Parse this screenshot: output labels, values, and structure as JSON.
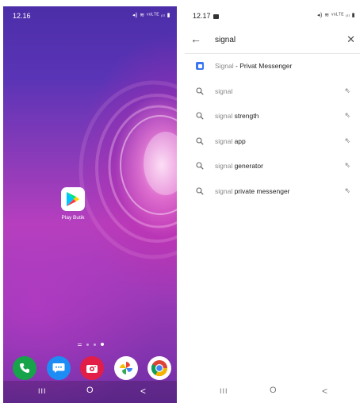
{
  "home": {
    "status": {
      "time": "12.16",
      "icons": "◂) ≋ ᵛᵒᴸᵀᴱ ᵢₗₗ ▮"
    },
    "play_app": {
      "label": "Play Butik"
    },
    "dock": [
      "phone",
      "messages",
      "camera",
      "photos",
      "chrome"
    ],
    "nav": {
      "recents": "III",
      "home": "O",
      "back": "<"
    }
  },
  "search": {
    "status": {
      "time": "12.17",
      "icons": "◂) ≋ ᵛᵒᴸᵀᴱ ᵢₗₗ ▮"
    },
    "query": "signal",
    "clear": "✕",
    "back": "←",
    "app_result": {
      "name": "Signal",
      "suffix": " - Privat Messenger"
    },
    "suggestions": [
      {
        "prefix": "signal",
        "suffix": ""
      },
      {
        "prefix": "signal",
        "suffix": " strength"
      },
      {
        "prefix": "signal",
        "suffix": " app"
      },
      {
        "prefix": "signal",
        "suffix": " generator"
      },
      {
        "prefix": "signal",
        "suffix": " private messenger"
      }
    ],
    "nav": {
      "recents": "III",
      "home": "O",
      "back": "<"
    }
  },
  "colors": {
    "accent": "#3a76f0",
    "phone": "#16a34a",
    "messages": "#1d8df5",
    "camera": "#e11d48"
  }
}
